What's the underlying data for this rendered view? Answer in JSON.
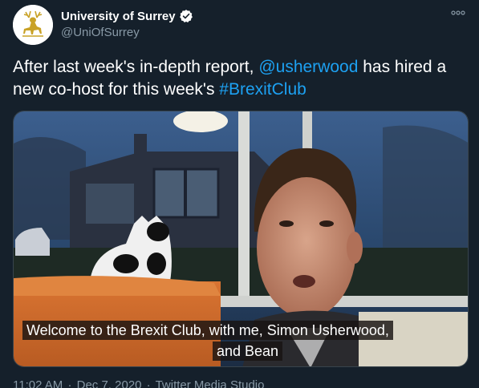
{
  "author": {
    "display_name": "University of Surrey",
    "handle": "@UniOfSurrey",
    "verified_icon": "verified-badge-icon",
    "avatar_icon": "stag-logo-icon"
  },
  "tweet": {
    "text_part1": "After last week's in-depth report, ",
    "mention": "@usherwood",
    "text_part2": " has hired a new co-host for this week's ",
    "hashtag": "#BrexitClub"
  },
  "media": {
    "caption_line1": "Welcome to the Brexit Club, with me, Simon Usherwood,",
    "caption_line2": "and Bean"
  },
  "meta": {
    "time": "11:02 AM",
    "separator": "·",
    "date": "Dec 7, 2020",
    "source": "Twitter Media Studio"
  },
  "colors": {
    "background": "#15202b",
    "link": "#1da1f2",
    "secondary_text": "#8899a6"
  }
}
